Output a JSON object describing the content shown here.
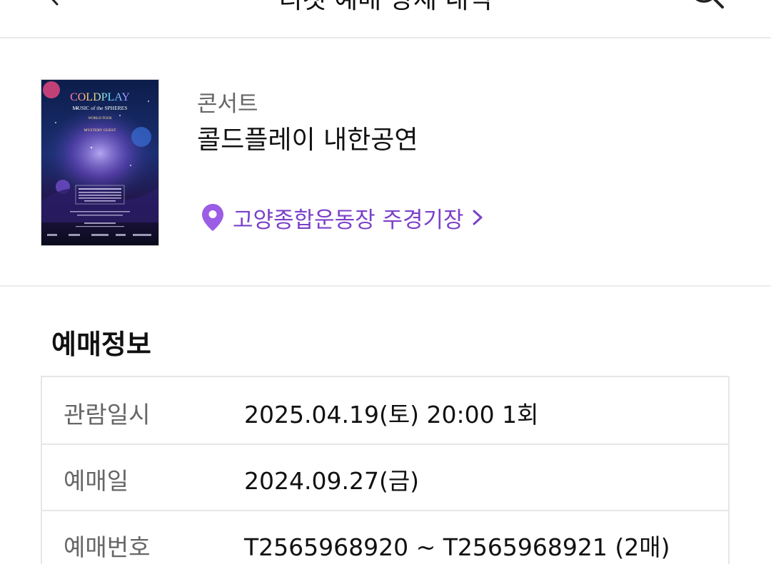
{
  "header": {
    "title": "티켓 예매 상세 내역",
    "back_icon": "back-arrow-icon",
    "search_icon": "search-icon"
  },
  "event": {
    "poster": {
      "headline": "COLDPLAY",
      "subtitle": "MUSIC of the SPHERES",
      "tour": "WORLD TOUR",
      "guest": "MYSTERY GUEST"
    },
    "category": "콘서트",
    "title": "콜드플레이 내한공연",
    "venue": "고양종합운동장 주경기장",
    "accent_color": "#7b40c9"
  },
  "booking": {
    "section_title": "예매정보",
    "rows": [
      {
        "label": "관람일시",
        "value": "2025.04.19(토) 20:00 1회"
      },
      {
        "label": "예매일",
        "value": "2024.09.27(금)"
      },
      {
        "label": "예매번호",
        "value": "T2565968920 ~ T2565968921 (2매)"
      }
    ]
  }
}
